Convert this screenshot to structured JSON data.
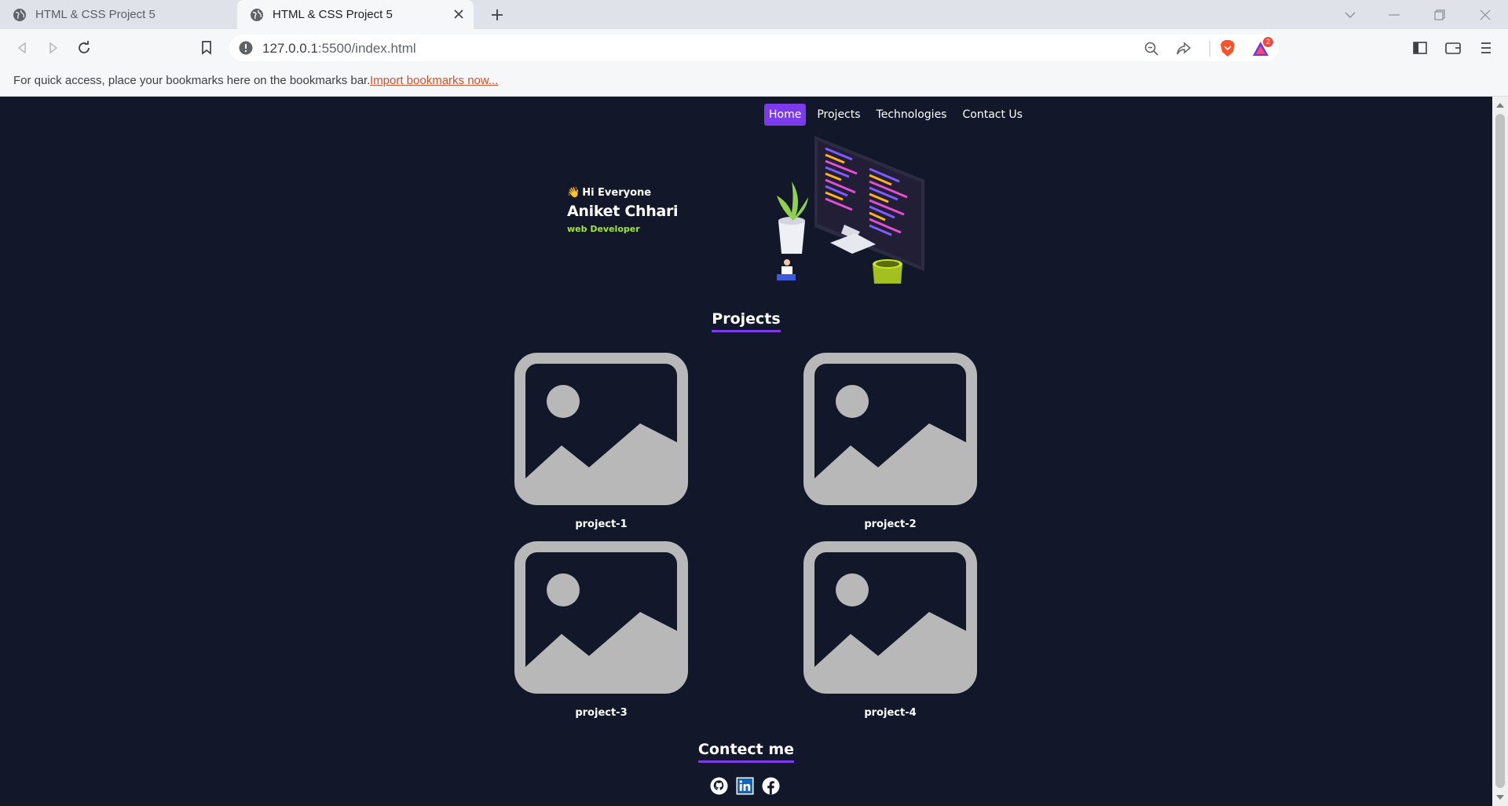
{
  "browser": {
    "tabs": [
      {
        "title": "HTML & CSS Project 5",
        "active": false
      },
      {
        "title": "HTML & CSS Project 5",
        "active": true
      }
    ],
    "url_host": "127.0.0.1",
    "url_path": ":5500/index.html",
    "brave_rewards_badge": "2",
    "bookmarks_bar": {
      "message": "For quick access, place your bookmarks here on the bookmarks bar.",
      "import_link": "Import bookmarks now..."
    }
  },
  "page": {
    "nav": [
      "Home",
      "Projects",
      "Technologies",
      "Contact Us"
    ],
    "nav_active": "Home",
    "hero": {
      "greeting_emoji": "👋",
      "greeting": "Hi Everyone",
      "name": "Aniket Chhari",
      "role": "web Developer"
    },
    "projects_title": "Projects",
    "projects": [
      "project-1",
      "project-2",
      "project-3",
      "project-4"
    ],
    "contact_title": "Contect me",
    "socials": [
      "github-icon",
      "linkedin-icon",
      "facebook-icon"
    ],
    "colors": {
      "background": "#121829",
      "accent": "#7c3aed",
      "role_text": "#a3e635",
      "placeholder": "#b8b8b8"
    }
  }
}
